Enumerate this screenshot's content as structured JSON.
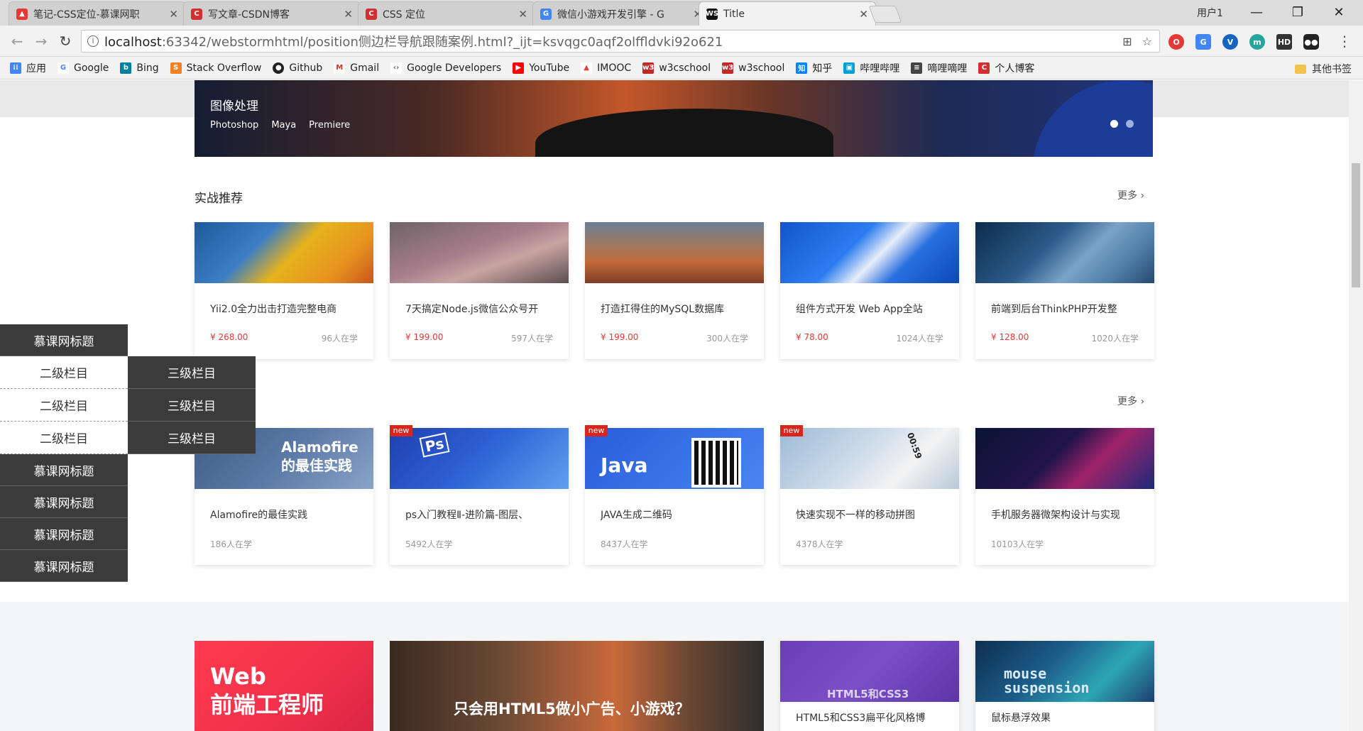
{
  "browser": {
    "tabs": [
      {
        "title": "笔记-CSS定位-慕课网职",
        "icon": "flame-icon",
        "color": "#e53935"
      },
      {
        "title": "写文章-CSDN博客",
        "icon": "csdn-icon",
        "color": "#d32f2f"
      },
      {
        "title": "CSS 定位",
        "icon": "csdn-icon",
        "color": "#d32f2f"
      },
      {
        "title": "微信小游戏开发引擎 - G",
        "icon": "google-icon",
        "color": "#4285f4"
      },
      {
        "title": "Title",
        "icon": "webstorm-icon",
        "color": "#111111"
      }
    ],
    "user_label": "用户1",
    "url_host": "localhost",
    "url_path": ":63342/webstormhtml/position侧边栏导航跟随案例.html?_ijt=ksvqgc0aqf2olffldvki92o621",
    "bookmarks": [
      {
        "label": "应用",
        "icon": "apps-icon",
        "color": "#4285f4"
      },
      {
        "label": "Google",
        "icon": "google-icon",
        "color": "#4285f4"
      },
      {
        "label": "Bing",
        "icon": "bing-icon",
        "color": "#00809d"
      },
      {
        "label": "Stack Overflow",
        "icon": "stackoverflow-icon",
        "color": "#f48024"
      },
      {
        "label": "Github",
        "icon": "github-icon",
        "color": "#222222"
      },
      {
        "label": "Gmail",
        "icon": "gmail-icon",
        "color": "#d93025"
      },
      {
        "label": "Google Developers",
        "icon": "developers-icon",
        "color": "#5f6368"
      },
      {
        "label": "YouTube",
        "icon": "youtube-icon",
        "color": "#ff0000"
      },
      {
        "label": "IMOOC",
        "icon": "imooc-icon",
        "color": "#e53935"
      },
      {
        "label": "w3cschool",
        "icon": "w3cschool-icon",
        "color": "#c62828"
      },
      {
        "label": "w3school",
        "icon": "w3school-icon",
        "color": "#c62828"
      },
      {
        "label": "知乎",
        "icon": "zhihu-icon",
        "color": "#0084ff"
      },
      {
        "label": "哔哩哔哩",
        "icon": "bilibili-icon",
        "color": "#00a1d6"
      },
      {
        "label": "嘀哩嘀哩",
        "icon": "dilidili-icon",
        "color": "#444444"
      },
      {
        "label": "个人博客",
        "icon": "blog-icon",
        "color": "#d32f2f"
      }
    ],
    "other_bookmarks": "其他书签"
  },
  "banner": {
    "title": "图像处理",
    "tags": [
      "Photoshop",
      "Maya",
      "Premiere"
    ]
  },
  "section1": {
    "title": "实战推荐",
    "more": "更多",
    "cards": [
      {
        "title": "Yii2.0全力出击打造完整电商",
        "price": "¥ 268.00",
        "students": "96人在学"
      },
      {
        "title": "7天搞定Node.js微信公众号开",
        "price": "¥ 199.00",
        "students": "597人在学"
      },
      {
        "title": "打造扛得住的MySQL数据库",
        "price": "¥ 199.00",
        "students": "300人在学"
      },
      {
        "title": "组件方式开发 Web App全站",
        "price": "¥ 78.00",
        "students": "1024人在学"
      },
      {
        "title": "前端到后台ThinkPHP开发整",
        "price": "¥ 128.00",
        "students": "1020人在学"
      }
    ]
  },
  "section2": {
    "more": "更多",
    "cards": [
      {
        "title": "Alamofire的最佳实践",
        "students": "186人在学",
        "thumb_text": "Alamofire 的最佳实践"
      },
      {
        "title": "ps入门教程Ⅱ-进阶篇-图层、",
        "students": "5492人在学",
        "badge": "new",
        "thumb_text": "Ps"
      },
      {
        "title": "JAVA生成二维码",
        "students": "8437人在学",
        "badge": "new",
        "thumb_text": "Java"
      },
      {
        "title": "快速实现不一样的移动拼图",
        "students": "4378人在学",
        "badge": "new",
        "thumb_text": "00:59"
      },
      {
        "title": "手机服务器微架构设计与实现",
        "students": "10103人在学"
      }
    ]
  },
  "section3": {
    "tile1_line1": "Web",
    "tile1_line2": "前端工程师",
    "tile2_text": "只会用HTML5做小广告、小游戏？",
    "tile3_caption": "HTML5和CSS3扁平化风格博",
    "tile3_overlay": "HTML5和CSS3",
    "tile4_caption": "鼠标悬浮效果",
    "tile4_text": "mouse suspension"
  },
  "sidebar": {
    "head": "慕课网标题",
    "sub_items": [
      "二级栏目",
      "二级栏目",
      "二级栏目"
    ],
    "third_items": [
      "三级栏目",
      "三级栏目",
      "三级栏目"
    ],
    "tail_items": [
      "慕课网标题",
      "慕课网标题",
      "慕课网标题",
      "慕课网标题"
    ]
  }
}
